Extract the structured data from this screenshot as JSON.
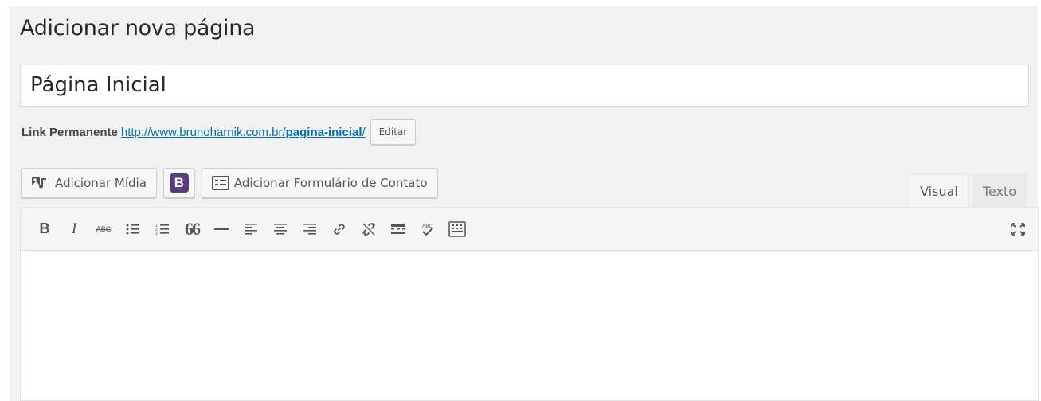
{
  "page": {
    "title": "Adicionar nova página"
  },
  "post": {
    "title_value": "Página Inicial",
    "title_placeholder": ""
  },
  "permalink": {
    "label": "Link Permanente",
    "url_prefix": "http://www.brunoharnik.com.br/",
    "slug": "pagina-inicial",
    "url_suffix": "/",
    "edit_label": "Editar"
  },
  "media_buttons": {
    "add_media": {
      "label": "Adicionar Mídia",
      "icon": "media-icon"
    },
    "bootstrap": {
      "label": "B",
      "icon": "bootstrap-icon",
      "color": "#563d7c"
    },
    "contact_form": {
      "label": "Adicionar Formulário de Contato",
      "icon": "form-icon"
    }
  },
  "editor_tabs": [
    {
      "label": "Visual",
      "active": true
    },
    {
      "label": "Texto",
      "active": false
    }
  ],
  "toolbar": {
    "buttons": [
      "bold-icon",
      "italic-icon",
      "strikethrough-icon",
      "bullet-list-icon",
      "numbered-list-icon",
      "blockquote-icon",
      "horizontal-rule-icon",
      "align-left-icon",
      "align-center-icon",
      "align-right-icon",
      "link-icon",
      "unlink-icon",
      "read-more-icon",
      "spellcheck-icon",
      "toolbar-toggle-icon",
      "fullscreen-icon"
    ],
    "bold_glyph": "B",
    "italic_glyph": "I",
    "strike_glyph": "ABC",
    "quote_glyph": "66",
    "spell_glyph": "ABC"
  },
  "colors": {
    "link": "#0073aa",
    "background": "#f1f1f1",
    "toolbar_bg": "#f5f5f5"
  }
}
